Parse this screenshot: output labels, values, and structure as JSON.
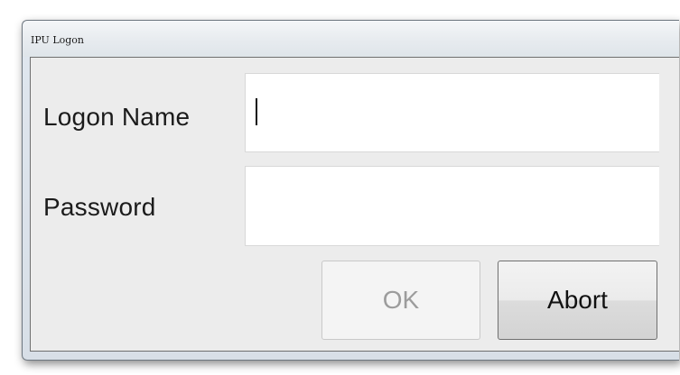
{
  "window": {
    "title": "IPU Logon"
  },
  "form": {
    "logon_name_label": "Logon Name",
    "logon_name_value": "",
    "password_label": "Password",
    "password_value": ""
  },
  "buttons": {
    "ok_label": "OK",
    "ok_enabled": false,
    "abort_label": "Abort"
  }
}
